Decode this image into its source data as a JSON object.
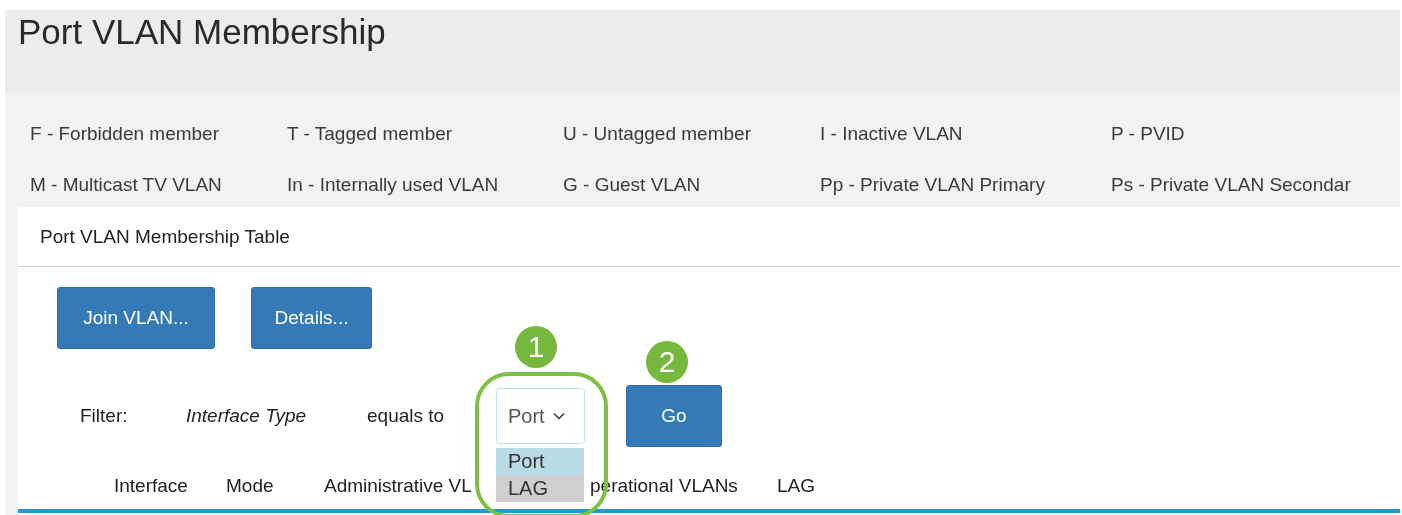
{
  "page": {
    "title": "Port VLAN Membership"
  },
  "legend": [
    {
      "text": "F - Forbidden member"
    },
    {
      "text": "T - Tagged member"
    },
    {
      "text": "U - Untagged member"
    },
    {
      "text": "I - Inactive VLAN"
    },
    {
      "text": "P - PVID"
    },
    {
      "text": "M - Multicast TV VLAN"
    },
    {
      "text": "In - Internally used VLAN"
    },
    {
      "text": "G - Guest VLAN"
    },
    {
      "text": "Pp - Private VLAN Primary"
    },
    {
      "text": "Ps - Private VLAN Secondar"
    }
  ],
  "panel": {
    "title": "Port VLAN Membership Table",
    "buttons": [
      "Join VLAN...",
      "Details..."
    ],
    "filter": {
      "label": "Filter:",
      "field": "Interface Type",
      "operator": "equals to",
      "select": {
        "value": "Port",
        "expanded": true,
        "options": [
          {
            "label": "Port",
            "selected": true
          },
          {
            "label": "LAG",
            "selected": false
          }
        ]
      },
      "go": "Go"
    },
    "callouts": [
      {
        "number": "1"
      },
      {
        "number": "2"
      }
    ],
    "columns": [
      "Interface",
      "Mode",
      "Administrative VL",
      "perational VLANs",
      "LAG"
    ]
  }
}
